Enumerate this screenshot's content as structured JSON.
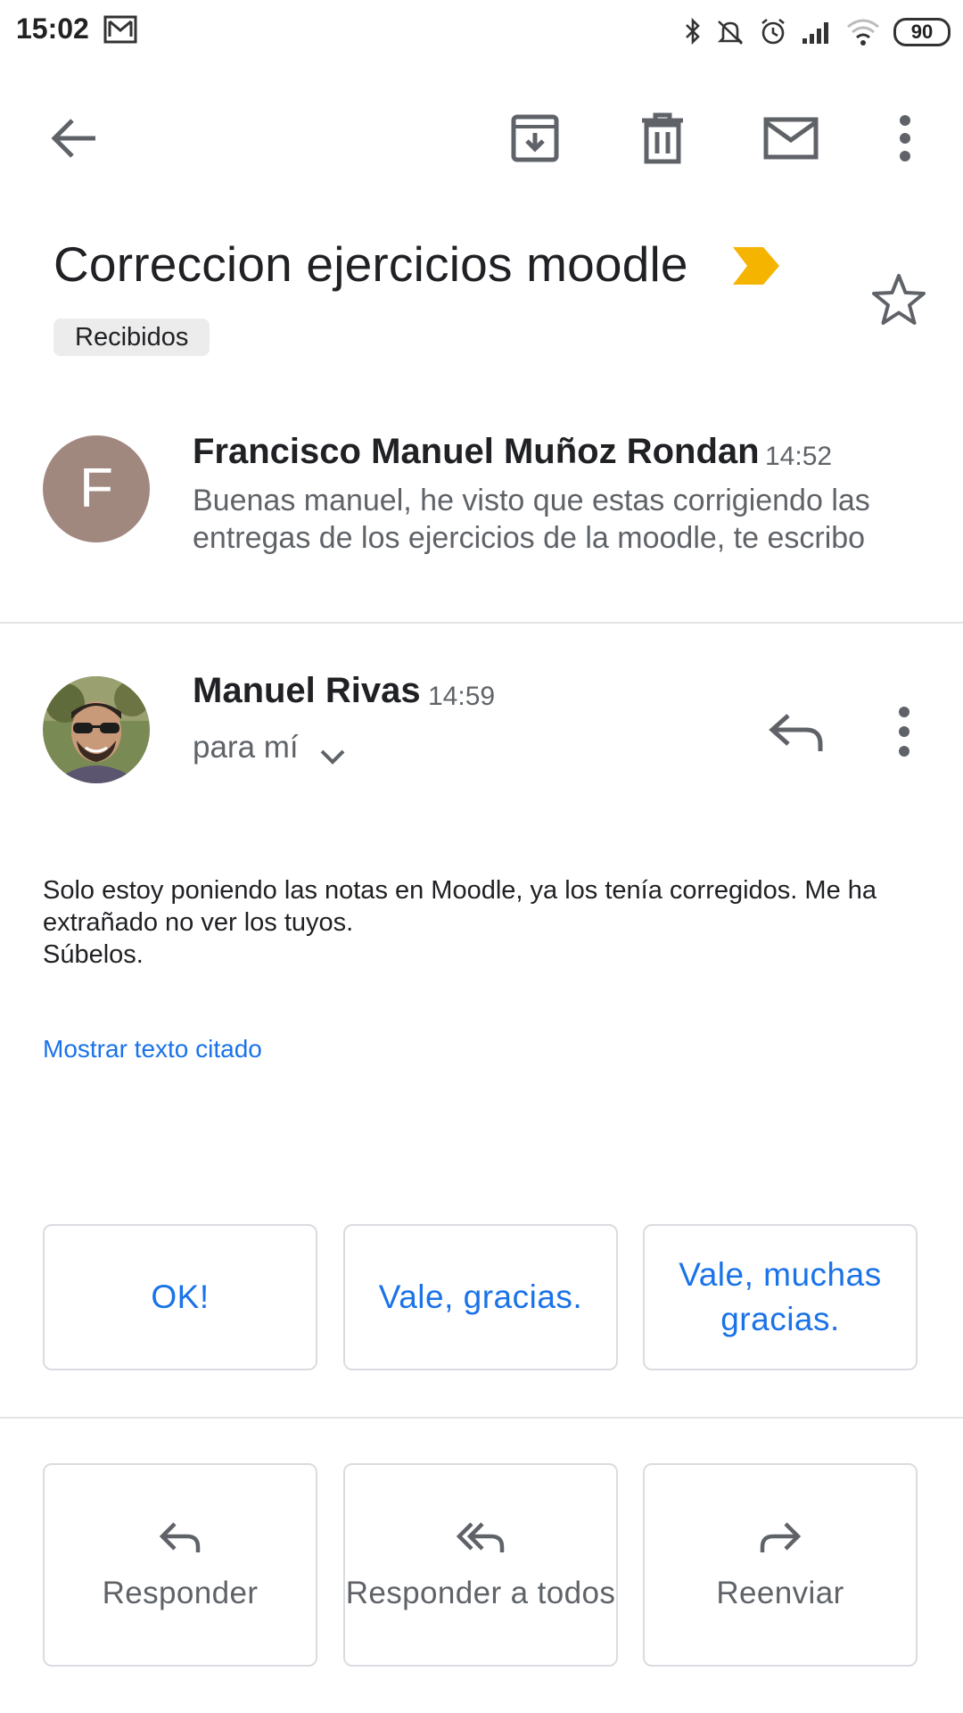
{
  "status_bar": {
    "time": "15:02",
    "battery": "90",
    "icons": [
      "gmail-notification-icon",
      "bluetooth-icon",
      "silent-icon",
      "alarm-icon",
      "signal-icon",
      "wifi-icon",
      "battery-icon"
    ]
  },
  "toolbar": {
    "icons": [
      "back-arrow-icon",
      "archive-icon",
      "delete-icon",
      "mark-unread-icon",
      "more-vert-icon"
    ]
  },
  "email": {
    "subject": "Correccion ejercicios moodle",
    "label": "Recibidos",
    "importance_color": "#f4b400"
  },
  "messages": [
    {
      "avatar_letter": "F",
      "avatar_color": "#a1887f",
      "sender": "Francisco Manuel Muñoz Rondan",
      "time": "14:52",
      "snippet": "Buenas manuel, he visto que estas corrigiendo las entregas de los ejercicios de la moodle, te escribo"
    },
    {
      "sender": "Manuel Rivas",
      "time": "14:59",
      "recipient": "para mí",
      "body_lines": [
        "Solo estoy poniendo las notas en Moodle, ya los tenía corregidos. Me ha",
        "extrañado no ver los tuyos.",
        "Súbelos."
      ],
      "show_quoted": "Mostrar texto citado"
    }
  ],
  "smart_replies": [
    "OK!",
    "Vale, gracias.",
    "Vale, muchas gracias."
  ],
  "actions": {
    "reply": "Responder",
    "reply_all": "Responder a todos",
    "forward": "Reenviar"
  },
  "colors": {
    "link_blue": "#1a73e8",
    "importance_yellow": "#f4b400",
    "divider": "#e4e4e4"
  }
}
